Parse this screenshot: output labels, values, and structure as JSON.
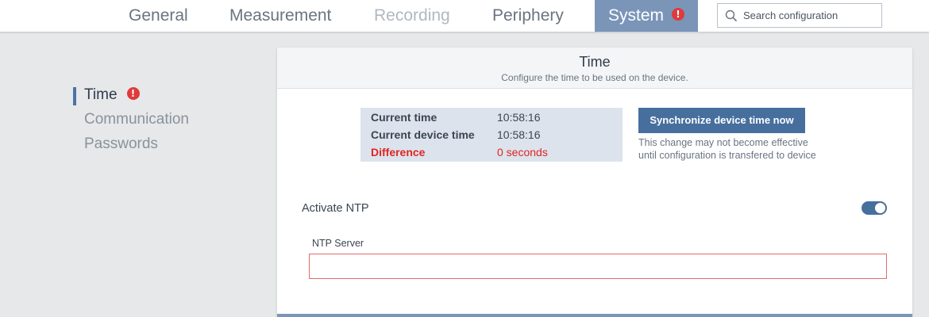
{
  "nav": {
    "tabs": [
      {
        "label": "General",
        "state": "normal"
      },
      {
        "label": "Measurement",
        "state": "normal"
      },
      {
        "label": "Recording",
        "state": "disabled"
      },
      {
        "label": "Periphery",
        "state": "normal"
      },
      {
        "label": "System",
        "state": "active",
        "alert": "!"
      }
    ],
    "search": {
      "placeholder": "Search configuration",
      "value": "",
      "icon": "search-icon"
    }
  },
  "sidebar": {
    "items": [
      {
        "label": "Time",
        "active": true,
        "alert": "!"
      },
      {
        "label": "Communication",
        "active": false
      },
      {
        "label": "Passwords",
        "active": false
      }
    ]
  },
  "card": {
    "title": "Time",
    "subtitle": "Configure the time to be used on the device.",
    "time_rows": [
      {
        "label": "Current time",
        "value": "10:58:16"
      },
      {
        "label": "Current device time",
        "value": "10:58:16"
      },
      {
        "label": "Difference",
        "value": "0 seconds"
      }
    ],
    "sync_button": "Synchronize device time now",
    "sync_note": "This change may not become effective until configuration is transfered to device",
    "ntp": {
      "label": "Activate NTP",
      "enabled": true
    },
    "ntp_server": {
      "label": "NTP Server",
      "value": ""
    }
  },
  "colors": {
    "accent": "#466f9e",
    "active_tab": "#7a95b8",
    "alert": "#e03a3a",
    "error_text": "#e02424"
  }
}
